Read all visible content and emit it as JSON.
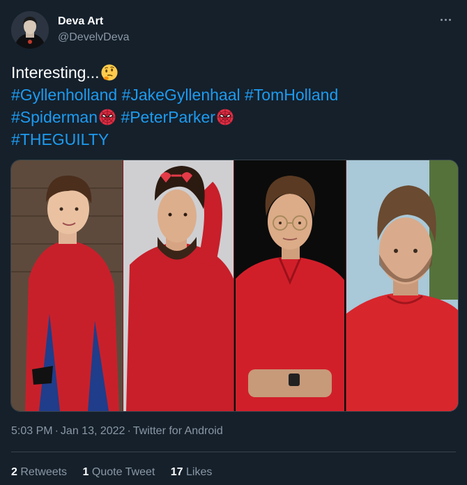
{
  "author": {
    "display_name": "Deva Art",
    "handle": "@DevelvDeva"
  },
  "tweet": {
    "intro": "Interesting...",
    "intro_emoji": "thinking-face-emoji",
    "hashtags_line1": [
      "#Gyllenholland",
      "#JakeGyllenhaal",
      "#TomHolland"
    ],
    "hashtags_line2": [
      "#Spiderman",
      "#PeterParker"
    ],
    "hashtags_line2_emoji": "spiderman-mask-emoji",
    "hashtags_line3": [
      "#THEGUILTY"
    ]
  },
  "media": {
    "photos": [
      {
        "name": "photo-spiderman-suit"
      },
      {
        "name": "photo-red-shirt-heart-glasses"
      },
      {
        "name": "photo-red-polo-glasses"
      },
      {
        "name": "photo-red-sweater"
      }
    ]
  },
  "meta": {
    "time": "5:03 PM",
    "date": "Jan 13, 2022",
    "source": "Twitter for Android",
    "separator": "·"
  },
  "stats": {
    "retweets_count": "2",
    "retweets_label": "Retweets",
    "quotes_count": "1",
    "quotes_label": "Quote Tweet",
    "likes_count": "17",
    "likes_label": "Likes"
  },
  "colors": {
    "background": "#15202b",
    "link": "#1d9bf0",
    "secondary_text": "#8b98a5",
    "divider": "#38444d"
  }
}
